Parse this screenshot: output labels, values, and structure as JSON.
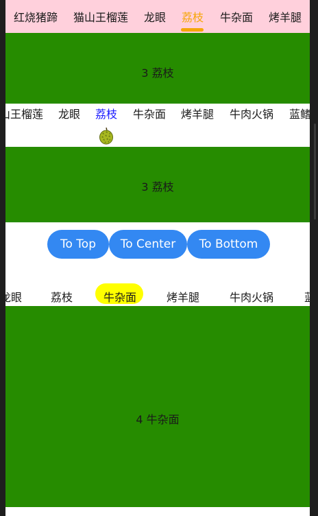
{
  "tabs_top": {
    "items": [
      "红烧猪蹄",
      "猫山王榴莲",
      "龙眼",
      "荔枝",
      "牛杂面",
      "烤羊腿"
    ],
    "active": "荔枝",
    "active_color": "#f6a609",
    "background": "#ffd0dc"
  },
  "panel_top": {
    "label": "3 荔枝"
  },
  "tabs_middle": {
    "items": [
      "山王榴莲",
      "龙眼",
      "荔枝",
      "牛杂面",
      "烤羊腿",
      "牛肉火锅",
      "蓝鳍"
    ],
    "active": "荔枝",
    "active_color": "#1a1aff",
    "indicator_icon": "durian-icon"
  },
  "panel_middle": {
    "label": "3 荔枝"
  },
  "buttons": {
    "to_top": "To Top",
    "to_center": "To Center",
    "to_bottom": "To Bottom",
    "color": "#3388f2"
  },
  "tabs_bottom": {
    "items": [
      "龙眼",
      "荔枝",
      "牛杂面",
      "烤羊腿",
      "牛肉火锅",
      "蓝"
    ],
    "active": "牛杂面",
    "active_background": "#ffff00"
  },
  "panel_bottom": {
    "label": "4 牛杂面"
  },
  "colors": {
    "panel_green": "#268c00"
  }
}
